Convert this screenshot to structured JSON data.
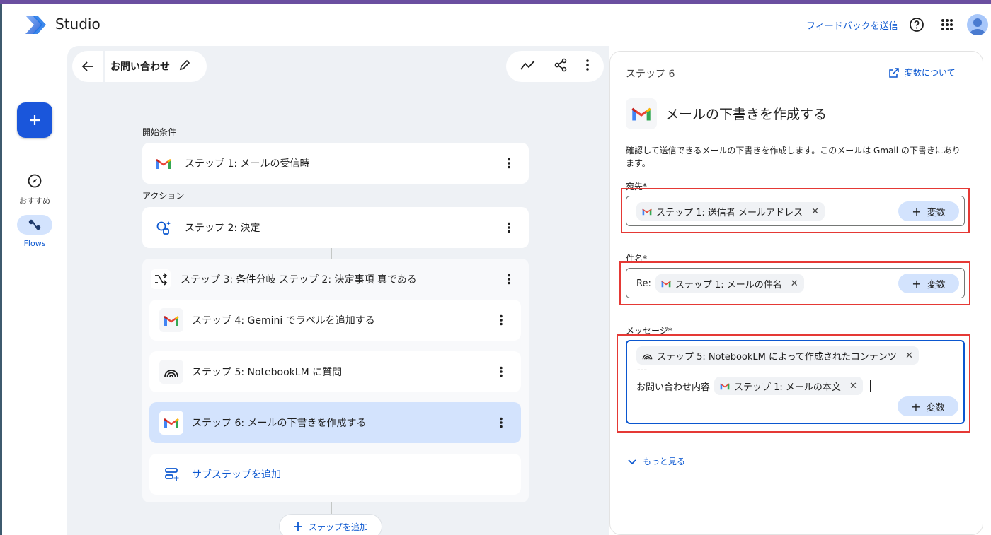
{
  "header": {
    "app_name": "Studio",
    "feedback_link": "フィードバックを送信",
    "help_icon": "help-icon",
    "apps_icon": "apps-grid-icon",
    "avatar": "account-avatar"
  },
  "rail": {
    "new_button_icon": "plus-icon",
    "items": [
      {
        "label": "おすすめ",
        "icon": "compass-icon"
      },
      {
        "label": "Flows",
        "icon": "flows-icon"
      }
    ]
  },
  "toolbar": {
    "flow_title": "お問い合わせ"
  },
  "flow": {
    "start_label": "開始条件",
    "action_label": "アクション",
    "step1": "ステップ 1: メールの受信時",
    "step2": "ステップ 2: 決定",
    "step3": "ステップ 3: 条件分岐 ステップ 2: 決定事項 真である",
    "step4": "ステップ 4: Gemini でラベルを追加する",
    "step5": "ステップ 5: NotebookLM に質問",
    "step6": "ステップ 6: メールの下書きを作成する",
    "add_substep": "サブステップを追加",
    "add_step": "ステップを追加"
  },
  "panel": {
    "step_label": "ステップ 6",
    "variables_link": "変数について",
    "title": "メールの下書きを作成する",
    "description": "確認して送信できるメールの下書きを作成します。このメールは Gmail の下書きにあります。",
    "to_label": "宛先*",
    "to_chip": "ステップ 1: 送信者 メールアドレス",
    "subject_label": "件名*",
    "subject_prefix": "Re:",
    "subject_chip": "ステップ 1: メールの件名",
    "message_label": "メッセージ*",
    "message_chip1": "ステップ 5: NotebookLM によって作成されたコンテンツ",
    "message_separator": "---",
    "message_text": "お問い合わせ内容",
    "message_chip2": "ステップ 1: メールの本文",
    "variable_button": "変数",
    "more_link": "もっと見る"
  },
  "colors": {
    "accent": "#0b57d0",
    "selected_step": "#d3e3fd",
    "highlight_box": "#e53935",
    "fab": "#1a56db"
  }
}
